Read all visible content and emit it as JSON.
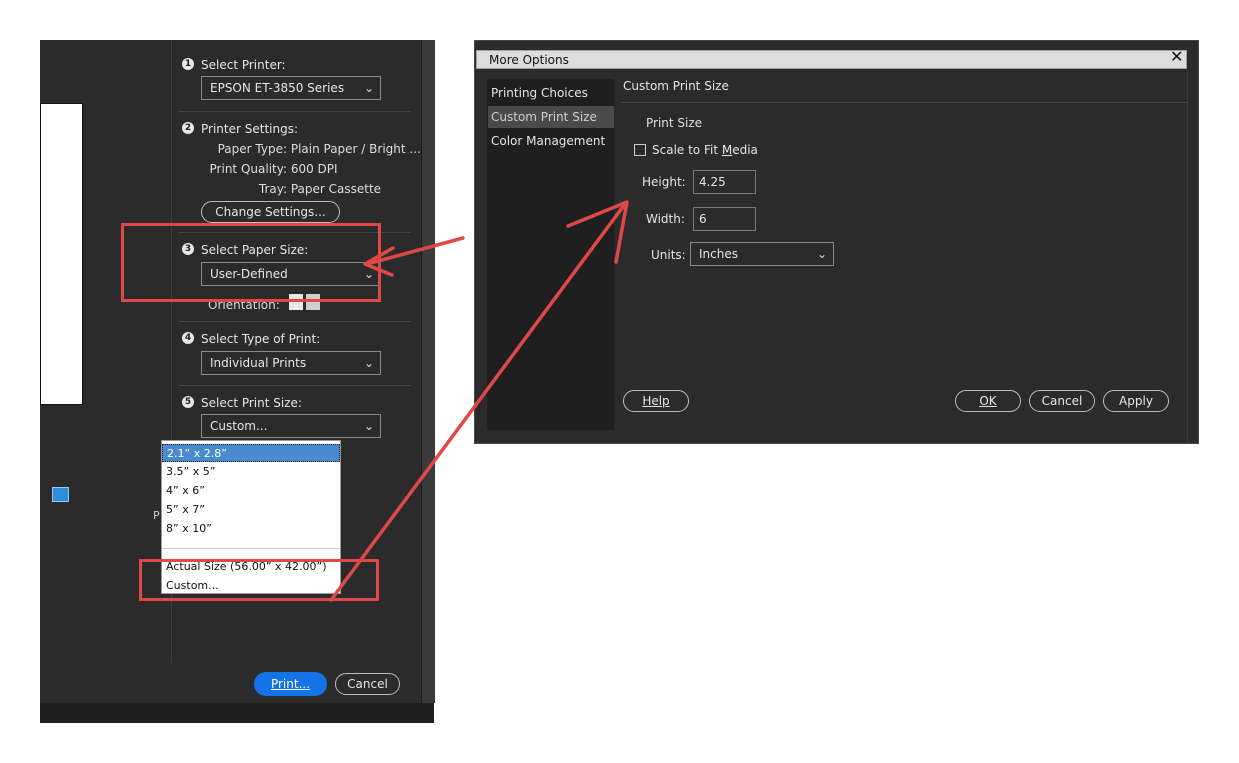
{
  "print_dialog": {
    "sections": {
      "printer": {
        "num": "1",
        "label": "Select Printer:",
        "value": "EPSON ET-3850 Series"
      },
      "printer_settings": {
        "num": "2",
        "label": "Printer Settings:",
        "paper_type_key": "Paper Type:",
        "paper_type_val": "Plain Paper / Bright ...",
        "quality_key": "Print Quality:",
        "quality_val": "600 DPI",
        "tray_key": "Tray:",
        "tray_val": "Paper Cassette",
        "change_button": "Change Settings..."
      },
      "paper_size": {
        "num": "3",
        "label": "Select Paper Size:",
        "value": "User-Defined",
        "orientation_label": "Orientation:"
      },
      "print_type": {
        "num": "4",
        "label": "Select Type of Print:",
        "value": "Individual Prints"
      },
      "print_size": {
        "num": "5",
        "label": "Select Print Size:",
        "value": "Custom...",
        "options": [
          "2.1” x 2.8”",
          "3.5” x 5”",
          "4” x 6”",
          "5” x 7”",
          "8” x 10”"
        ],
        "actual_size": "Actual Size (56.00” x 42.00”)",
        "custom": "Custom..."
      }
    },
    "stub_text": "P",
    "print_button": "Print...",
    "cancel_button": "Cancel"
  },
  "more_options": {
    "title": "More Options",
    "close": "✕",
    "nav": [
      "Printing Choices",
      "Custom Print Size",
      "Color Management"
    ],
    "panel_title": "Custom Print Size",
    "print_size_heading": "Print Size",
    "scale_to_fit_pre": "Scale to Fit ",
    "scale_to_fit_ul": "M",
    "scale_to_fit_post": "edia",
    "height_label": "Height:",
    "height_value": "4.25",
    "width_label": "Width:",
    "width_value": "6",
    "units_label": "Units:",
    "units_value": "Inches",
    "help": "Help",
    "ok": "OK",
    "cancel": "Cancel",
    "apply": "Apply"
  },
  "colors": {
    "annotation": "#e04848",
    "primary": "#1473e6",
    "dialog_bg": "#2b2b2b"
  }
}
